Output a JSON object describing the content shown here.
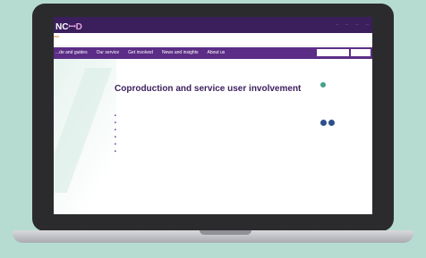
{
  "header": {
    "logo_text": "NC",
    "logo_mark": "ꟷD",
    "util_links": [
      "...",
      "...",
      "...",
      "..."
    ]
  },
  "banner": {
    "tag": "",
    "text": ""
  },
  "nav": {
    "items": [
      "...de and guides",
      "Our service",
      "Get involved",
      "News and insights",
      "About us"
    ],
    "search_placeholder": "",
    "search2": ""
  },
  "page": {
    "breadcrumb": "",
    "title": "Coproduction and service user involvement",
    "toc": [
      "",
      "",
      "",
      "",
      "",
      ""
    ]
  },
  "sidebar": {
    "badge": "",
    "share_label": "",
    "note": ""
  }
}
